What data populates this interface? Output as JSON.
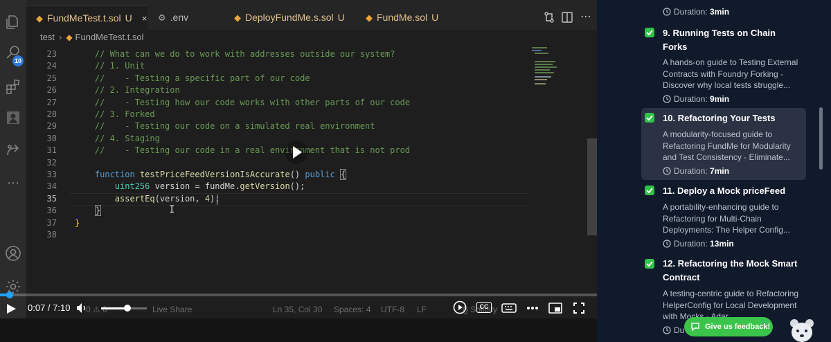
{
  "editor": {
    "tabs": [
      {
        "name": "FundMeTest.t.sol",
        "mark": "U",
        "icon": "solidity-file-icon",
        "active": true
      },
      {
        "name": ".env",
        "mark": "",
        "icon": "gear-file-icon",
        "active": false
      },
      {
        "name": "DeployFundMe.s.sol",
        "mark": "U",
        "icon": "solidity-file-icon",
        "active": false
      },
      {
        "name": "FundMe.sol",
        "mark": "U",
        "icon": "solidity-file-icon",
        "active": false
      }
    ],
    "close_glyph": "×",
    "search_badge": "10",
    "breadcrumb": {
      "folder": "test",
      "file": "FundMeTest.t.sol"
    },
    "line_numbers": [
      "23",
      "24",
      "25",
      "26",
      "27",
      "28",
      "29",
      "30",
      "31",
      "32",
      "33",
      "34",
      "35",
      "36",
      "37",
      "38"
    ],
    "code_lines": [
      "    // What can we do to work with addresses outside our system?",
      "    // 1. Unit",
      "    //    - Testing a specific part of our code",
      "    // 2. Integration",
      "    //    - Testing how our code works with other parts of our code",
      "    // 3. Forked",
      "    //    - Testing our code on a simulated real environment",
      "    // 4. Staging",
      "    //    - Testing our code in a real environment that is not prod",
      "",
      "    function testPriceFeedVersionIsAccurate() public {",
      "        uint256 version = fundMe.getVersion();",
      "        assertEq(version, 4);",
      "    }",
      "}",
      ""
    ],
    "current_line": "35",
    "status": {
      "branch": "0 ⚠ 0",
      "live_share": "Live Share",
      "position": "Ln 35, Col 30",
      "spaces": "Spaces: 4",
      "encoding": "UTF-8",
      "eol": "LF",
      "lang": "{} Solidity"
    }
  },
  "video": {
    "time": "0:07 / 7:10",
    "progress": 0.016,
    "volume": 0.58,
    "cc_label": "CC"
  },
  "lessons": [
    {
      "title": "",
      "desc": "",
      "duration_label": "Duration:",
      "duration": "3min",
      "active": false
    },
    {
      "title": "9. Running Tests on Chain Forks",
      "desc": "A hands-on guide to Testing External Contracts with Foundry Forking - Discover why local tests struggle...",
      "duration_label": "Duration:",
      "duration": "9min",
      "active": false
    },
    {
      "title": "10. Refactoring Your Tests",
      "desc": "A modularity-focused guide to Refactoring FundMe for Modularity and Test Consistency - Eliminate...",
      "duration_label": "Duration:",
      "duration": "7min",
      "active": true
    },
    {
      "title": "11. Deploy a Mock priceFeed",
      "desc": "A portability-enhancing guide to Refactoring for Multi-Chain Deployments: The Helper Config...",
      "duration_label": "Duration:",
      "duration": "13min",
      "active": false
    },
    {
      "title": "12. Refactoring the Mock Smart Contract",
      "desc": "A testing-centric guide to Refactoring HelperConfig for Local Development with Mocks - Adar...",
      "duration_label": "Du",
      "duration": "",
      "active": false
    }
  ],
  "feedback_label": "Give us feedback!",
  "colors": {
    "check": "#33c24a",
    "progress": "#1fa3ff",
    "feedback": "#3bc44a",
    "active_lesson_bg": "#2a3243"
  }
}
